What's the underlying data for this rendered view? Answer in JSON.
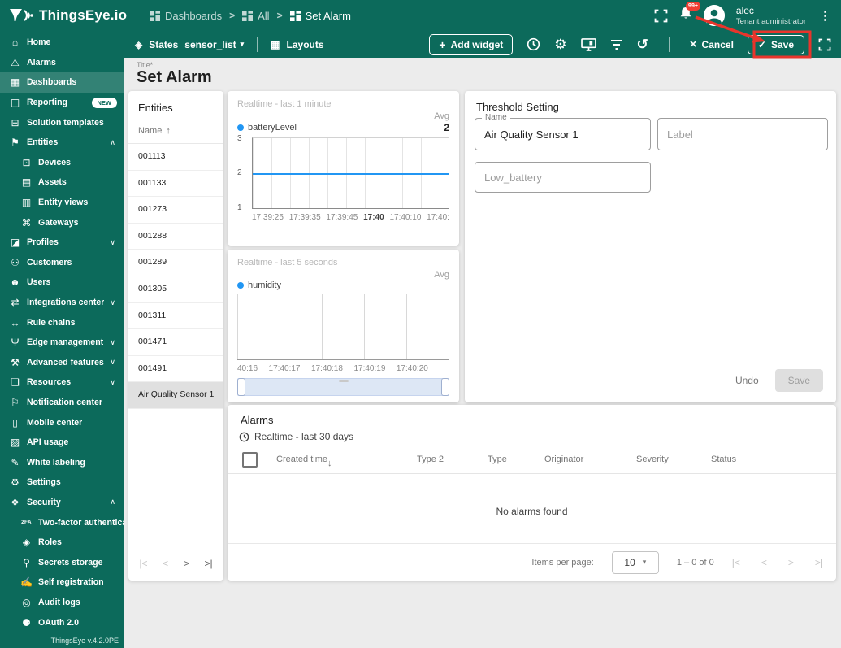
{
  "colors": {
    "accent": "#0c6a5b",
    "annotation": "#e8352c",
    "series_blue": "#2196f3"
  },
  "header": {
    "logo_text": "ThingsEye.io",
    "breadcrumbs": [
      {
        "label": "Dashboards"
      },
      {
        "label": "All"
      },
      {
        "label": "Set Alarm"
      }
    ],
    "separator": ">",
    "notification_badge": "99+",
    "user_name": "alec",
    "user_role": "Tenant administrator",
    "kebab_glyph": "⋮"
  },
  "toolbar": {
    "states_icon_glyph": "◈",
    "states_label": "States",
    "states_value": "sensor_list",
    "states_caret": "▾",
    "layouts_icon_glyph": "▦",
    "layouts_label": "Layouts",
    "plus_glyph": "+",
    "add_widget_label": "Add widget",
    "history_glyph": "↺",
    "gear_glyph": "⚙",
    "cancel_glyph": "×",
    "cancel_label": "Cancel",
    "check_glyph": "✓",
    "save_label": "Save"
  },
  "sidebar": {
    "footer": "ThingsEye v.4.2.0PE",
    "items": [
      {
        "name": "home",
        "label": "Home",
        "glyph": "⌂"
      },
      {
        "name": "alarms",
        "label": "Alarms",
        "glyph": "⚠"
      },
      {
        "name": "dashboards",
        "label": "Dashboards",
        "glyph": "▦",
        "active": true
      },
      {
        "name": "reporting",
        "label": "Reporting",
        "glyph": "◫",
        "badge": "NEW"
      },
      {
        "name": "solution-templates",
        "label": "Solution templates",
        "glyph": "⊞"
      },
      {
        "name": "entities",
        "label": "Entities",
        "glyph": "⚑",
        "chevron": "up"
      },
      {
        "name": "devices",
        "label": "Devices",
        "glyph": "⊡",
        "sub": true
      },
      {
        "name": "assets",
        "label": "Assets",
        "glyph": "▤",
        "sub": true
      },
      {
        "name": "entity-views",
        "label": "Entity views",
        "glyph": "▥",
        "sub": true
      },
      {
        "name": "gateways",
        "label": "Gateways",
        "glyph": "⌘",
        "sub": true
      },
      {
        "name": "profiles",
        "label": "Profiles",
        "glyph": "◪",
        "chevron": "down"
      },
      {
        "name": "customers",
        "label": "Customers",
        "glyph": "⚇"
      },
      {
        "name": "users",
        "label": "Users",
        "glyph": "☻"
      },
      {
        "name": "integrations-center",
        "label": "Integrations center",
        "glyph": "⇄",
        "chevron": "down"
      },
      {
        "name": "rule-chains",
        "label": "Rule chains",
        "glyph": "↔"
      },
      {
        "name": "edge-management",
        "label": "Edge management",
        "glyph": "Ψ",
        "chevron": "down"
      },
      {
        "name": "advanced-features",
        "label": "Advanced features",
        "glyph": "⚒",
        "chevron": "down"
      },
      {
        "name": "resources",
        "label": "Resources",
        "glyph": "❏",
        "chevron": "down"
      },
      {
        "name": "notification-center",
        "label": "Notification center",
        "glyph": "⚐"
      },
      {
        "name": "mobile-center",
        "label": "Mobile center",
        "glyph": "▯"
      },
      {
        "name": "api-usage",
        "label": "API usage",
        "glyph": "▨"
      },
      {
        "name": "white-labeling",
        "label": "White labeling",
        "glyph": "✎"
      },
      {
        "name": "settings",
        "label": "Settings",
        "glyph": "⚙"
      },
      {
        "name": "security",
        "label": "Security",
        "glyph": "❖",
        "chevron": "up"
      },
      {
        "name": "two-factor-authentication",
        "label": "Two-factor authenticati...",
        "glyph": "2FA",
        "sub": true
      },
      {
        "name": "roles",
        "label": "Roles",
        "glyph": "◈",
        "sub": true
      },
      {
        "name": "secrets-storage",
        "label": "Secrets storage",
        "glyph": "⚲",
        "sub": true
      },
      {
        "name": "self-registration",
        "label": "Self registration",
        "glyph": "✍",
        "sub": true
      },
      {
        "name": "audit-logs",
        "label": "Audit logs",
        "glyph": "◎",
        "sub": true
      },
      {
        "name": "oauth",
        "label": "OAuth 2.0",
        "glyph": "⚈",
        "sub": true
      }
    ]
  },
  "page": {
    "title_label": "Title*",
    "title": "Set Alarm"
  },
  "entities_widget": {
    "title": "Entities",
    "column": "Name",
    "sort_glyph": "↑",
    "rows": [
      "001113",
      "001133",
      "001273",
      "001288",
      "001289",
      "001305",
      "001311",
      "001471",
      "001491",
      "Air Quality Sensor 1"
    ],
    "selected_row": "Air Quality Sensor 1",
    "pager": [
      "|<",
      "<",
      ">",
      ">|"
    ],
    "pager_disabled": [
      true,
      true,
      false,
      false
    ]
  },
  "chart_data": [
    {
      "type": "line",
      "title": "Realtime - last 1 minute",
      "agg_header": "Avg",
      "series": [
        {
          "name": "batteryLevel",
          "color": "#2196f3",
          "constant_value": 2,
          "avg": 2
        }
      ],
      "x_ticks": [
        "17:39:25",
        "17:39:35",
        "17:39:45",
        "17:40",
        "17:40:10",
        "17:40:"
      ],
      "bold_x_tick": "17:40",
      "y_ticks": [
        3,
        2,
        1
      ],
      "ylim": [
        1,
        3
      ],
      "grid": true,
      "legend_position": "top"
    },
    {
      "type": "line",
      "title": "Realtime - last 5 seconds",
      "agg_header": "Avg",
      "series": [
        {
          "name": "humidity",
          "color": "#2196f3",
          "values": []
        }
      ],
      "x_ticks": [
        "40:16",
        "17:40:17",
        "17:40:18",
        "17:40:19",
        "17:40:20"
      ],
      "y_ticks": [],
      "grid": true,
      "legend_position": "top",
      "has_range_selector": true
    }
  ],
  "threshold": {
    "title": "Threshold Setting",
    "name_label": "Name",
    "name_value": "Air Quality Sensor 1",
    "label_placeholder": "Label",
    "key_placeholder": "Low_battery",
    "undo_label": "Undo",
    "save_label": "Save"
  },
  "alarms_widget": {
    "title": "Alarms",
    "timewindow": "Realtime - last 30 days",
    "columns": [
      "Created time",
      "Type 2",
      "Type",
      "Originator",
      "Severity",
      "Status"
    ],
    "sorted_column": "Created time",
    "sort_glyph": "↓",
    "empty_text": "No alarms found",
    "items_per_page_label": "Items per page:",
    "page_size": "10",
    "select_caret": "▾",
    "range_text": "1 – 0 of 0",
    "pager": [
      "|<",
      "<",
      ">",
      ">|"
    ],
    "pager_disabled": [
      true,
      true,
      true,
      true
    ]
  }
}
